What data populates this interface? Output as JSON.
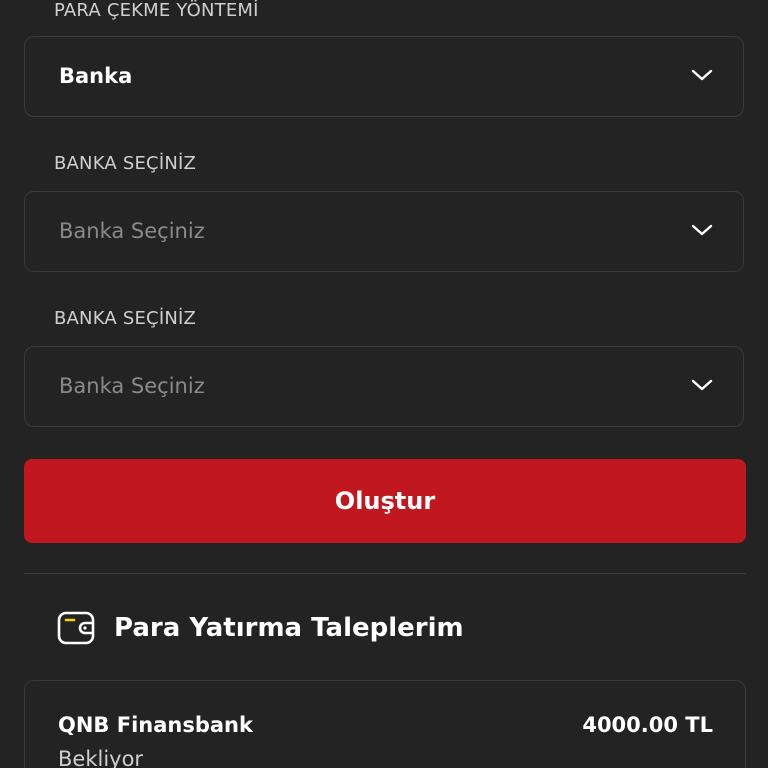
{
  "withdraw_method": {
    "label": "PARA ÇEKME YÖNTEMİ",
    "value": "Banka",
    "icon": "chevron-down-icon"
  },
  "bank_select_1": {
    "label": "BANKA SEÇİNİZ",
    "placeholder": "Banka Seçiniz",
    "icon": "chevron-down-icon"
  },
  "bank_select_2": {
    "label": "BANKA SEÇİNİZ",
    "placeholder": "Banka Seçiniz",
    "icon": "chevron-down-icon"
  },
  "submit": {
    "label": "Oluştur"
  },
  "deposit_requests": {
    "title": "Para Yatırma Taleplerim",
    "icon": "wallet-icon",
    "items": [
      {
        "bank": "QNB Finansbank",
        "amount": "4000.00 TL",
        "status": "Bekliyor"
      }
    ]
  },
  "colors": {
    "background": "#232323",
    "border": "#3a3a3a",
    "accent": "#c1171f",
    "text": "#ffffff",
    "muted": "#8a8a8a"
  }
}
